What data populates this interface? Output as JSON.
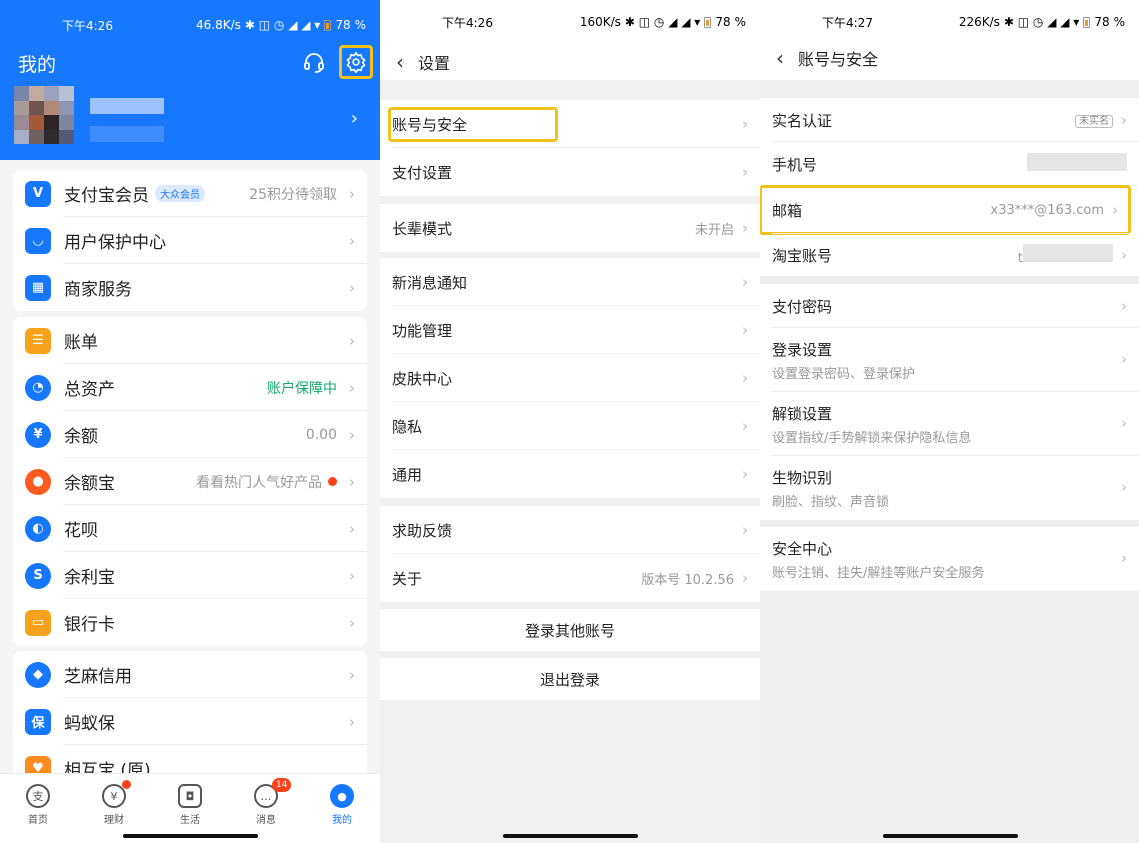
{
  "colors": {
    "primary": "#1677ff",
    "highlight": "#f2c21b",
    "green": "#17a86b",
    "danger": "#ff411c"
  },
  "panel1": {
    "status": {
      "time": "下午4:26",
      "speed": "46.8K/s",
      "battery": "78",
      "percent": "%"
    },
    "title": "我的",
    "icons": {
      "service": "headset-icon",
      "settings": "gear-icon"
    },
    "card1": [
      {
        "label": "支付宝会员",
        "badge": "大众会员",
        "right": "25积分待领取",
        "icon": "member-icon",
        "color": "#1677ff"
      },
      {
        "label": "用户保护中心",
        "right": "",
        "icon": "shield-icon",
        "color": "#1677ff"
      },
      {
        "label": "商家服务",
        "right": "",
        "icon": "store-icon",
        "color": "#1677ff"
      }
    ],
    "card2": [
      {
        "label": "账单",
        "right": "",
        "icon": "bill-icon",
        "color": "#f7a21b"
      },
      {
        "label": "总资产",
        "right": "账户保障中",
        "icon": "pie-icon",
        "color": "#1677ff"
      },
      {
        "label": "余额",
        "right": "0.00",
        "icon": "yuan-icon",
        "color": "#1677ff"
      },
      {
        "label": "余额宝",
        "right": "看看热门人气好产品",
        "icon": "yuebao-icon",
        "color": "#ff5a1f"
      },
      {
        "label": "花呗",
        "right": "",
        "icon": "huabei-icon",
        "color": "#1677ff"
      },
      {
        "label": "余利宝",
        "right": "",
        "icon": "yulibao-icon",
        "color": "#1677ff"
      },
      {
        "label": "银行卡",
        "right": "",
        "icon": "card-icon",
        "color": "#f7a21b"
      }
    ],
    "card3": [
      {
        "label": "芝麻信用",
        "icon": "sesame-icon",
        "color": "#1677ff"
      },
      {
        "label": "蚂蚁保",
        "icon": "insurance-icon",
        "color": "#1677ff"
      },
      {
        "label": "相互宝 (原)",
        "icon": "heart-icon",
        "color": "#ff8a1f"
      }
    ],
    "tabs": [
      {
        "label": "首页",
        "glyph": "支"
      },
      {
        "label": "理财",
        "glyph": "¥",
        "dot": true
      },
      {
        "label": "生活",
        "glyph": "◘"
      },
      {
        "label": "消息",
        "glyph": "…",
        "badge": "14"
      },
      {
        "label": "我的",
        "glyph": "●",
        "active": true
      }
    ]
  },
  "panel2": {
    "status": {
      "time": "下午4:26",
      "speed": "160K/s",
      "battery": "78",
      "percent": "%"
    },
    "title": "设置",
    "group1": [
      {
        "label": "账号与安全"
      },
      {
        "label": "支付设置"
      }
    ],
    "group2": [
      {
        "label": "长辈模式",
        "right": "未开启"
      }
    ],
    "group3": [
      {
        "label": "新消息通知"
      },
      {
        "label": "功能管理"
      },
      {
        "label": "皮肤中心"
      },
      {
        "label": "隐私"
      },
      {
        "label": "通用"
      }
    ],
    "group4": [
      {
        "label": "求助反馈"
      },
      {
        "label": "关于",
        "right": "版本号 10.2.56"
      }
    ],
    "login_other": "登录其他账号",
    "logout": "退出登录"
  },
  "panel3": {
    "status": {
      "time": "下午4:27",
      "speed": "226K/s",
      "battery": "78",
      "percent": "%"
    },
    "title": "账号与安全",
    "realname": {
      "label": "实名认证",
      "tag": "未实名"
    },
    "phone": {
      "label": "手机号"
    },
    "email": {
      "label": "邮箱",
      "value": "x33***@163.com"
    },
    "taobao": {
      "label": "淘宝账号",
      "value": "t"
    },
    "paypwd": {
      "label": "支付密码"
    },
    "login": {
      "title": "登录设置",
      "sub": "设置登录密码、登录保护"
    },
    "unlock": {
      "title": "解锁设置",
      "sub": "设置指纹/手势解锁来保护隐私信息"
    },
    "bio": {
      "title": "生物识别",
      "sub": "刷脸、指纹、声音锁"
    },
    "safety": {
      "title": "安全中心",
      "sub": "账号注销、挂失/解挂等账户安全服务"
    }
  }
}
